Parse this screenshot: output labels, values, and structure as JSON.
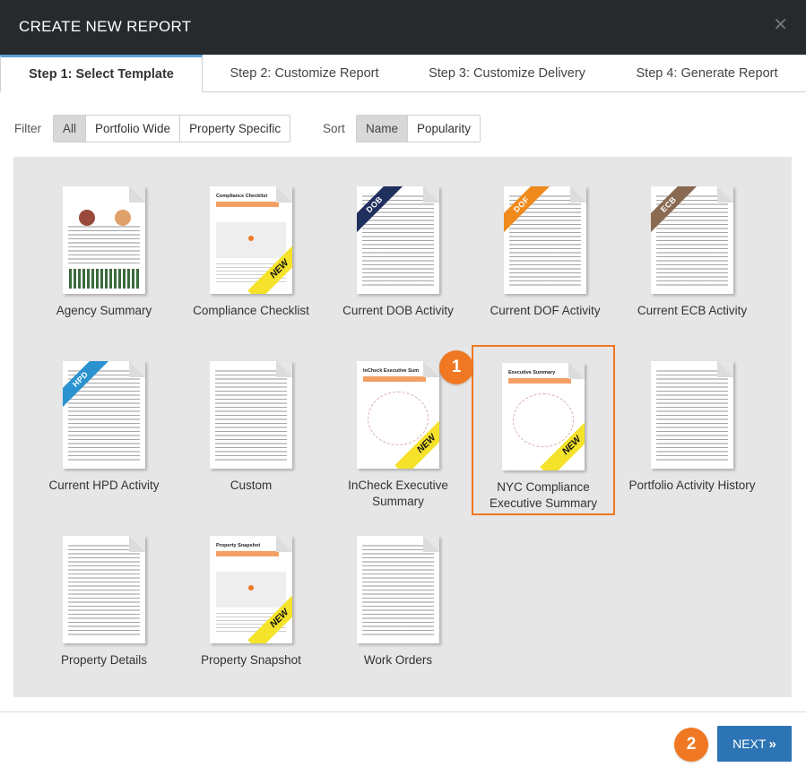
{
  "dialog": {
    "title": "CREATE NEW REPORT",
    "close_glyph": "✕"
  },
  "tabs": [
    {
      "label": "Step 1: Select Template",
      "active": true
    },
    {
      "label": "Step 2: Customize Report",
      "active": false
    },
    {
      "label": "Step 3: Customize Delivery",
      "active": false
    },
    {
      "label": "Step 4: Generate Report",
      "active": false
    }
  ],
  "filter": {
    "label": "Filter",
    "options": [
      "All",
      "Portfolio Wide",
      "Property Specific"
    ],
    "selected": "All"
  },
  "sort": {
    "label": "Sort",
    "options": [
      "Name",
      "Popularity"
    ],
    "selected": "Name"
  },
  "templates": [
    {
      "label": "Agency Summary",
      "style": "agency",
      "ribbon": null,
      "is_new": false
    },
    {
      "label": "Compliance Checklist",
      "style": "map",
      "doc_title": "Compliance Checklist",
      "ribbon": null,
      "is_new": true
    },
    {
      "label": "Current DOB Activity",
      "style": "rows",
      "ribbon": "DOB",
      "ribbon_color": "#1f2f5e",
      "is_new": false
    },
    {
      "label": "Current DOF Activity",
      "style": "rows",
      "ribbon": "DOF",
      "ribbon_color": "#f08a1c",
      "is_new": false
    },
    {
      "label": "Current ECB Activity",
      "style": "rows",
      "ribbon": "ECB",
      "ribbon_color": "#8a6a52",
      "is_new": false
    },
    {
      "label": "Current HPD Activity",
      "style": "rows",
      "ribbon": "HPD",
      "ribbon_color": "#2a93cf",
      "is_new": false
    },
    {
      "label": "Custom",
      "style": "rows",
      "ribbon": null,
      "is_new": false
    },
    {
      "label": "InCheck Executive Summary",
      "style": "diagram",
      "doc_title": "InCheck Executive Sum",
      "ribbon": null,
      "is_new": true
    },
    {
      "label": "NYC Compliance Executive Summary",
      "style": "diagram",
      "doc_title": "Executive Summary",
      "ribbon": null,
      "is_new": true,
      "selected": true
    },
    {
      "label": "Portfolio Activity History",
      "style": "rows",
      "ribbon": null,
      "is_new": false
    },
    {
      "label": "Property Details",
      "style": "rows",
      "ribbon": null,
      "is_new": false
    },
    {
      "label": "Property Snapshot",
      "style": "map",
      "doc_title": "Property Snapshot",
      "ribbon": null,
      "is_new": true
    },
    {
      "label": "Work Orders",
      "style": "rows",
      "ribbon": null,
      "is_new": false
    }
  ],
  "new_badge": "NEW",
  "markers": {
    "first": "1",
    "second": "2"
  },
  "next_button": {
    "label": "NEXT",
    "icon": "double-chevron-right-icon",
    "glyph": "»"
  },
  "colors": {
    "accent": "#f07822",
    "primary_button": "#2d74b5",
    "header_bg": "#262a2d",
    "active_tab": "#5c9fd4"
  }
}
